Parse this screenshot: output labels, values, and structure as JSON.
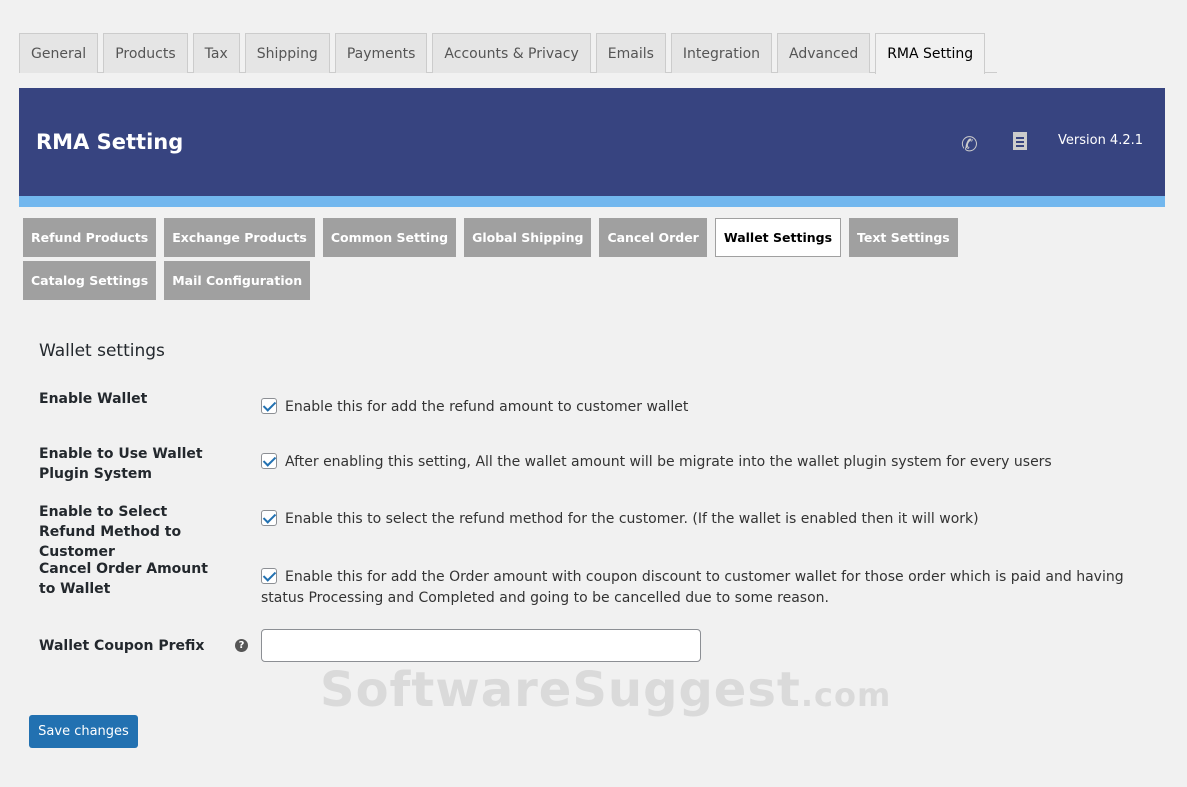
{
  "nav_tabs": [
    "General",
    "Products",
    "Tax",
    "Shipping",
    "Payments",
    "Accounts & Privacy",
    "Emails",
    "Integration",
    "Advanced",
    "RMA Setting"
  ],
  "banner": {
    "title": "RMA Setting",
    "version": "Version 4.2.1"
  },
  "sub_tabs": [
    "Refund Products",
    "Exchange Products",
    "Common Setting",
    "Global Shipping",
    "Cancel Order",
    "Wallet Settings",
    "Text Settings",
    "Catalog Settings",
    "Mail Configuration"
  ],
  "section_title": "Wallet settings",
  "settings": [
    {
      "label": "Enable Wallet",
      "desc": "Enable this for add the refund amount to customer wallet",
      "checked": true
    },
    {
      "label": "Enable to Use Wallet Plugin System",
      "desc": "After enabling this setting, All the wallet amount will be migrate into the wallet plugin system for every users",
      "checked": true
    },
    {
      "label": "Enable to Select Refund Method to Customer",
      "desc": "Enable this to select the refund method for the customer. (If the wallet is enabled then it will work)",
      "checked": true
    },
    {
      "label": "Cancel Order Amount to Wallet",
      "desc": "Enable this for add the Order amount with coupon discount to customer wallet for those order which is paid and having status Processing and Completed and going to be cancelled due to some reason.",
      "checked": true
    }
  ],
  "coupon_prefix": {
    "label": "Wallet Coupon Prefix",
    "value": "",
    "help": "?"
  },
  "save_label": "Save changes",
  "watermark": {
    "main": "SoftwareSuggest",
    "suffix": ".com"
  }
}
